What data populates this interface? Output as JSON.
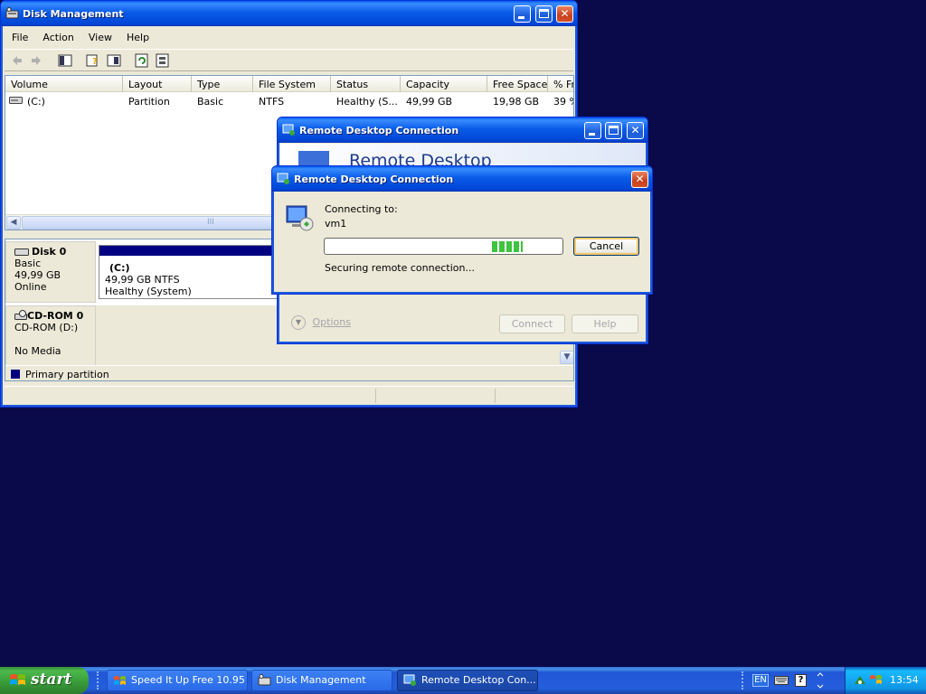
{
  "disk_mgmt": {
    "title": "Disk Management",
    "menu": [
      "File",
      "Action",
      "View",
      "Help"
    ],
    "columns": [
      "Volume",
      "Layout",
      "Type",
      "File System",
      "Status",
      "Capacity",
      "Free Space",
      "% Fr"
    ],
    "rows": [
      [
        "(C:)",
        "Partition",
        "Basic",
        "NTFS",
        "Healthy (S...",
        "49,99 GB",
        "19,98 GB",
        "39 %"
      ]
    ],
    "scroll_grip": "III",
    "disks": [
      {
        "name": "Disk 0",
        "type": "Basic",
        "size": "49,99 GB",
        "state": "Online",
        "partition": {
          "label": "(C:)",
          "size_fs": "49,99 GB NTFS",
          "status": "Healthy (System)"
        }
      },
      {
        "name": "CD-ROM 0",
        "type": "CD-ROM (D:)",
        "size": "",
        "state": "No Media"
      }
    ],
    "legend": "Primary partition"
  },
  "rdp_back": {
    "title": "Remote Desktop Connection",
    "banner": "Remote Desktop",
    "options_label": "Options",
    "connect_label": "Connect",
    "help_label": "Help"
  },
  "rdp_dialog": {
    "title": "Remote Desktop Connection",
    "connecting_label": "Connecting to:",
    "host": "vm1",
    "cancel_label": "Cancel",
    "status": "Securing remote connection..."
  },
  "taskbar": {
    "start_label": "start",
    "items": [
      {
        "label": "Speed It Up Free 10.95",
        "icon": "speed-it-up-icon"
      },
      {
        "label": "Disk Management",
        "icon": "disk-management-icon"
      },
      {
        "label": "Remote Desktop Con...",
        "icon": "remote-desktop-icon"
      }
    ],
    "lang": "EN",
    "clock": "13:54"
  },
  "colors": {
    "desktop": "#0a0a4a",
    "primary_partition": "#000080",
    "progress_fill": "#3ec43e"
  }
}
